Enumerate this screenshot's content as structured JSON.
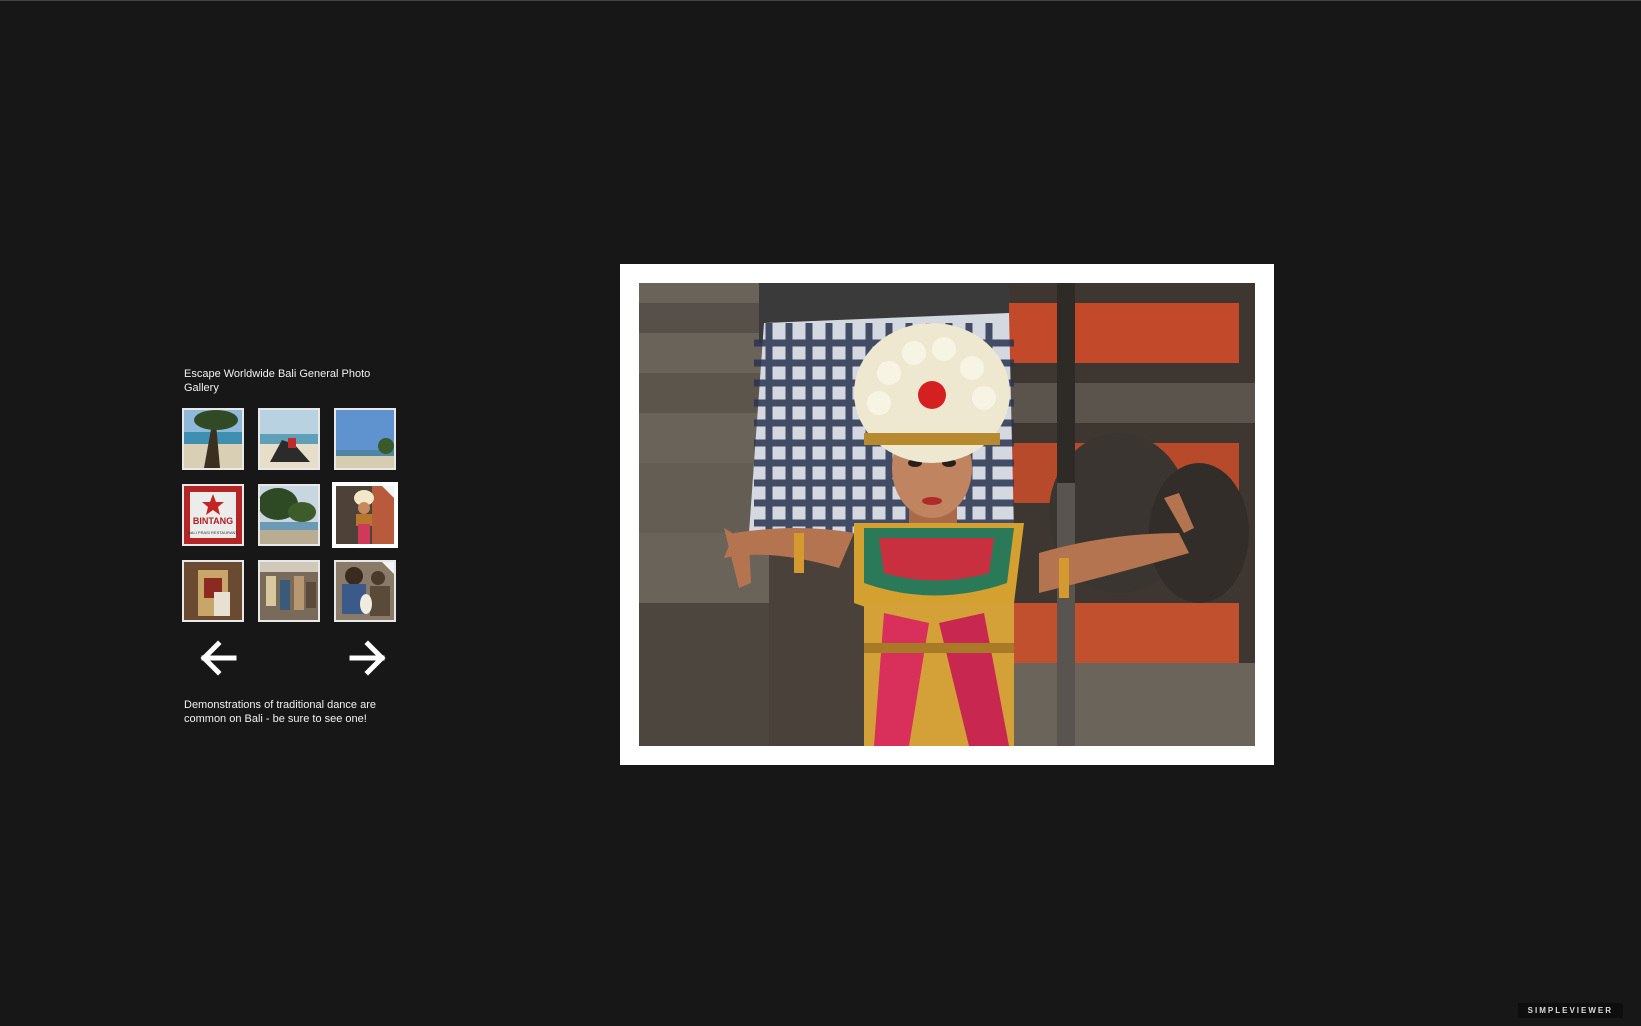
{
  "gallery": {
    "title": "Escape Worldwide Bali General Photo Gallery",
    "caption": "Demonstrations of traditional dance are common on Bali - be sure to see one!",
    "thumbnails": [
      {
        "name": "beach-tree",
        "selected": false
      },
      {
        "name": "beach-rocks",
        "selected": false
      },
      {
        "name": "beach-sky",
        "selected": false
      },
      {
        "name": "bintang-sign",
        "selected": false,
        "text_line1": "BINTANG",
        "text_line2": "BALI PRASI RESTAURANT"
      },
      {
        "name": "trees-sea",
        "selected": false
      },
      {
        "name": "dancer",
        "selected": true
      },
      {
        "name": "costume",
        "selected": false
      },
      {
        "name": "market",
        "selected": false
      },
      {
        "name": "carving",
        "selected": false
      }
    ],
    "prev_icon": "arrow-left-icon",
    "next_icon": "arrow-right-icon"
  },
  "branding": {
    "label": "SIMPLEVIEWER"
  },
  "colors": {
    "background": "#171717",
    "frame": "#ffffff",
    "text": "#f2f2f2"
  }
}
